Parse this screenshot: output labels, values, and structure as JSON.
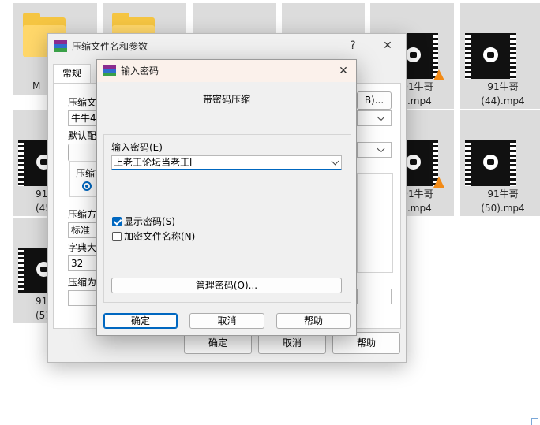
{
  "explorer": {
    "tiles": [
      {
        "label": "_M"
      },
      {
        "label": "91牛哥\n(44).mp4"
      },
      {
        "label": "91牛哥\n(50).mp4"
      },
      {
        "label": "91牛哥\n).mp4"
      },
      {
        "label": "91牛哥\n).mp4"
      },
      {
        "label": "91\n(45"
      },
      {
        "label": "91\n(51"
      }
    ]
  },
  "back_dialog": {
    "title": "压缩文件名和参数",
    "help_glyph": "?",
    "close_glyph": "✕",
    "tab_general": "常规",
    "label_archive_name": "压缩文",
    "archive_name_value": "牛牛41",
    "browse_suffix": "B)...",
    "label_default_profile": "默认配",
    "label_format_group": "压缩文",
    "format_radio_text": "I",
    "label_method": "压缩方",
    "method_value": "标准",
    "label_dict_size": "字典大",
    "dict_value": "32",
    "label_split": "压缩为",
    "ok": "确定",
    "cancel": "取消",
    "help": "帮助"
  },
  "password_dialog": {
    "title": "输入密码",
    "close_glyph": "✕",
    "heading": "带密码压缩",
    "label_enter_password": "输入密码(E)",
    "password_value": "上老王论坛当老王l",
    "show_password": {
      "label": "显示密码(S)",
      "checked": true
    },
    "encrypt_names": {
      "label": "加密文件名称(N)",
      "checked": false
    },
    "manage_button": "管理密码(O)...",
    "ok": "确定",
    "cancel": "取消",
    "help": "帮助"
  }
}
